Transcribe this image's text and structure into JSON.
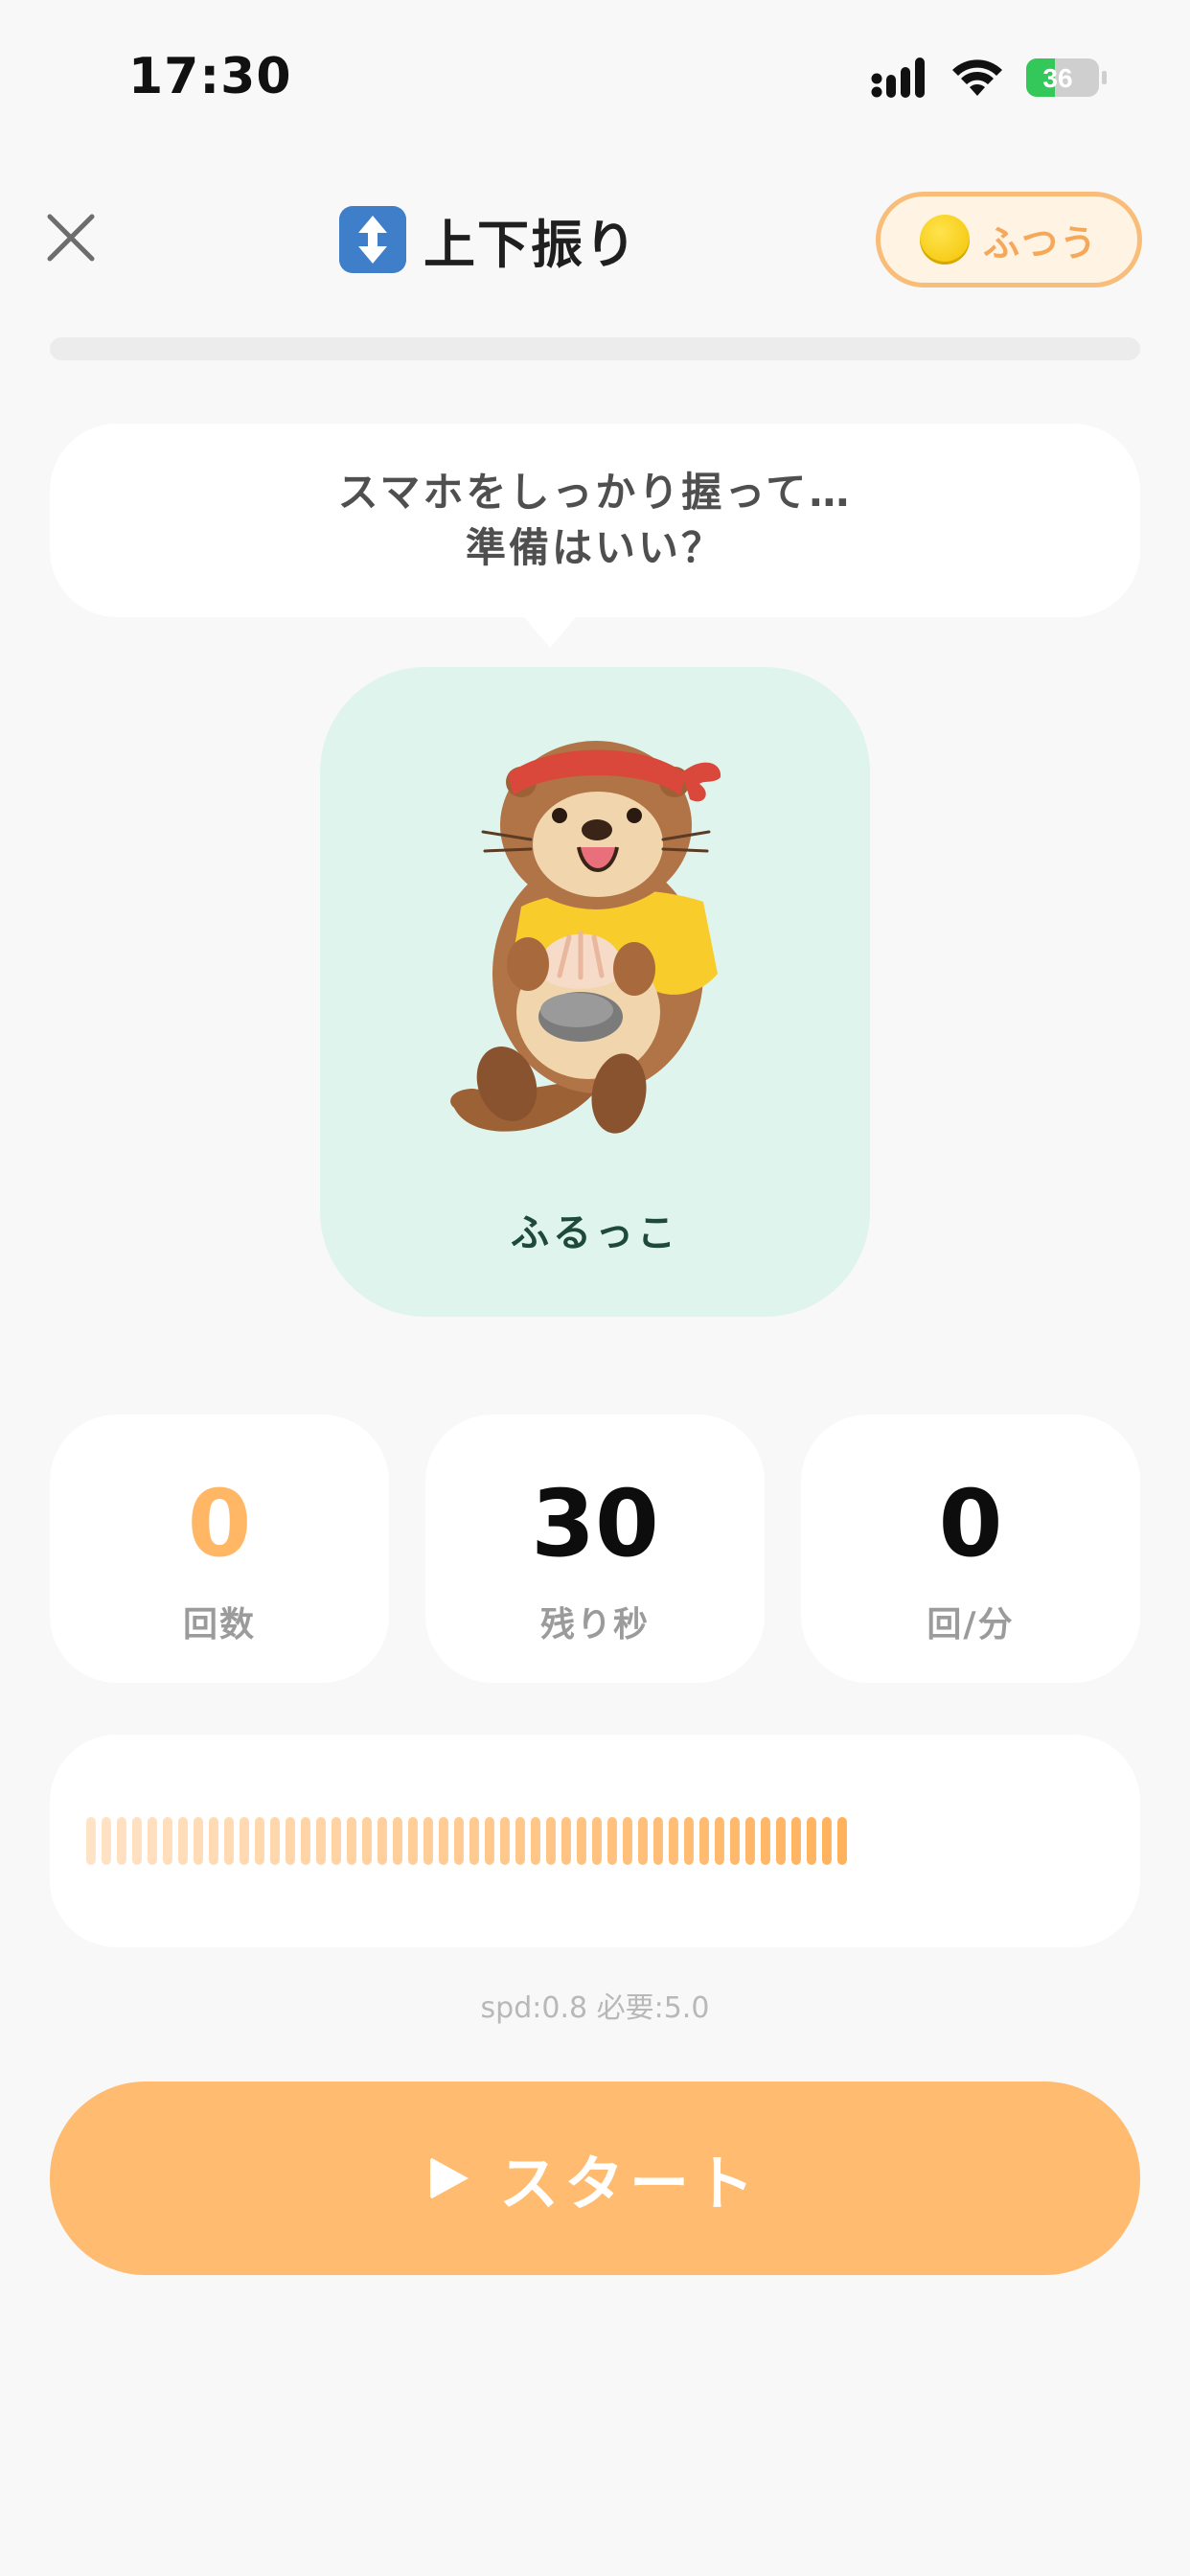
{
  "status_bar": {
    "time": "17:30",
    "battery_level": "36"
  },
  "header": {
    "title": "上下振り",
    "title_icon": "up-down-arrow-icon",
    "mode_label": "ふつう",
    "mode_dot_color": "#f2c200"
  },
  "progress": {
    "fraction": 0.0
  },
  "bubble": {
    "line1": "スマホをしっかり握って…",
    "line2": "準備はいい？"
  },
  "character": {
    "name": "ふるっこ",
    "image": "otter-illustration"
  },
  "stats": [
    {
      "value": "0",
      "label": "回数"
    },
    {
      "value": "30",
      "label": "残り秒"
    },
    {
      "value": "0",
      "label": "回/分"
    }
  ],
  "meter": {
    "bar_count": 50,
    "start_color": "#ffe3c6",
    "end_color": "#ffb25d"
  },
  "speed_readout": "spd:0.8 必要:5.0",
  "start_button": {
    "label": "スタート",
    "icon": "play-icon"
  },
  "colors": {
    "accent": "#ffbb70",
    "card_green": "#e0f4ee",
    "background": "#f8f8f8"
  }
}
